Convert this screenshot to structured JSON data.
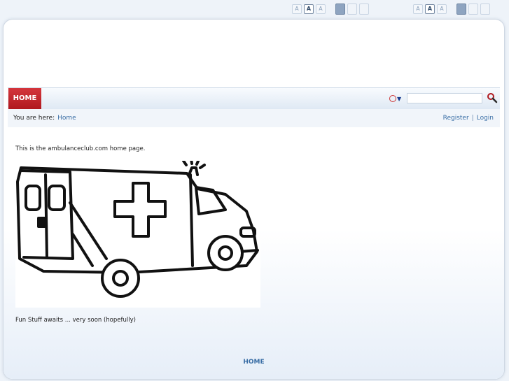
{
  "font_controls_left": {
    "small": "A",
    "medium": "A",
    "large": "A"
  },
  "font_controls_right": {
    "small": "A",
    "medium": "A",
    "large": "A"
  },
  "nav": {
    "home_label": "HOME"
  },
  "search": {
    "placeholder": ""
  },
  "breadcrumb": {
    "label": "You are here:",
    "current": "Home"
  },
  "user_links": {
    "register": "Register",
    "separator": "|",
    "login": "Login"
  },
  "content": {
    "intro": "This is the ambulanceclub.com home page.",
    "footnote": "Fun Stuff awaits ... very soon (hopefully)"
  },
  "footer": {
    "home_label": "HOME"
  },
  "colors": {
    "accent_red": "#c0222a",
    "link_blue": "#3a6ea5"
  }
}
